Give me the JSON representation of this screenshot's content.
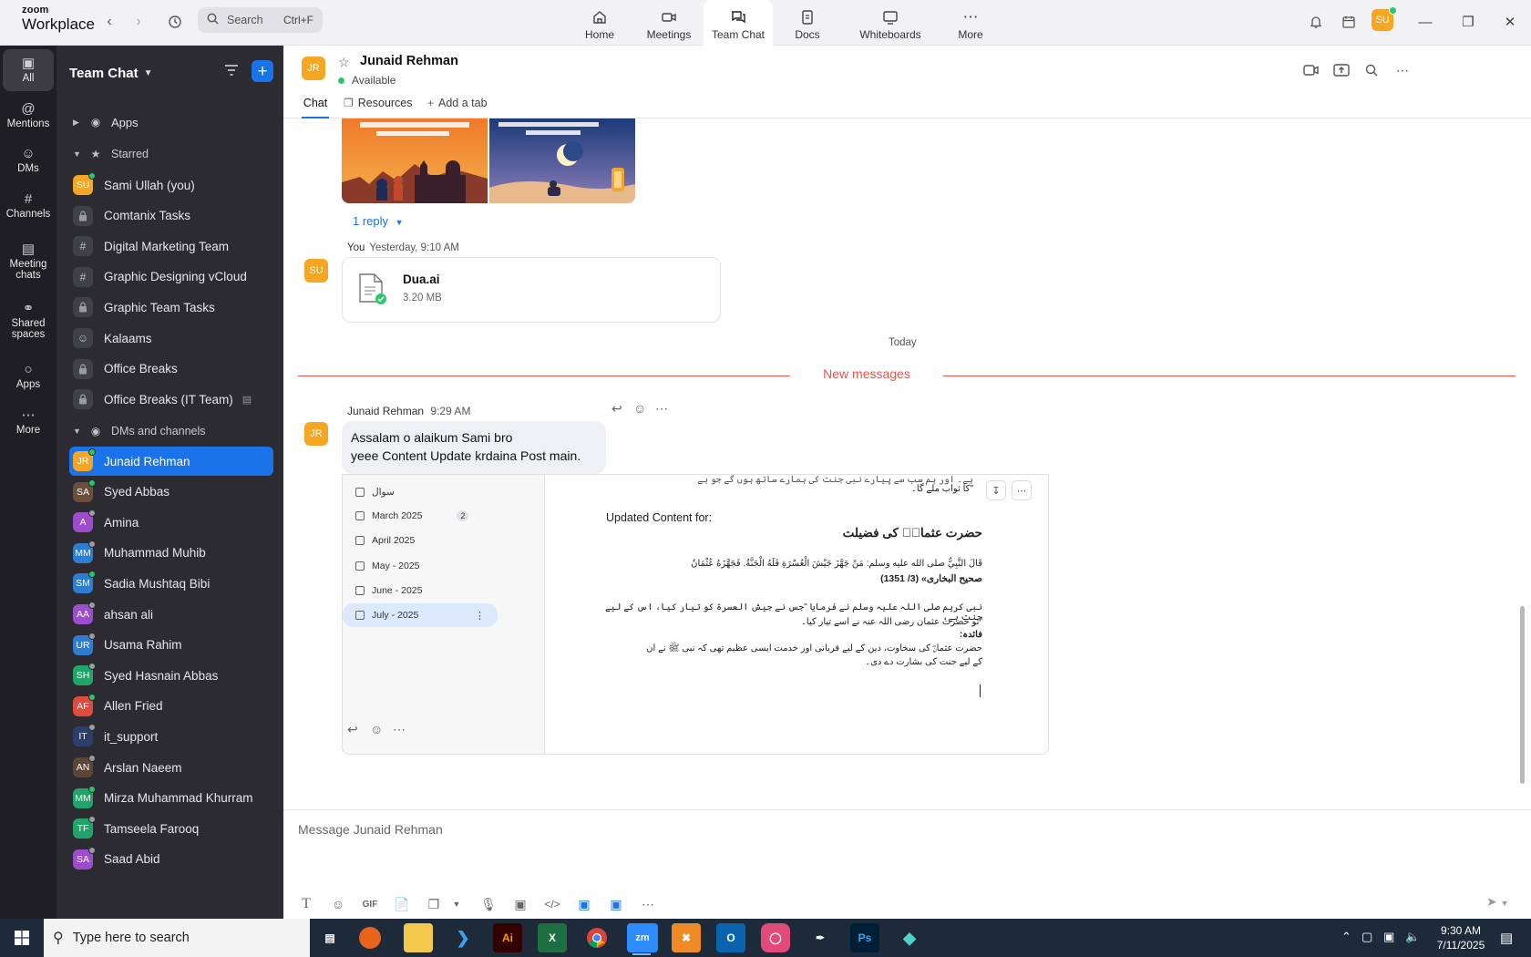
{
  "titlebar": {
    "brand_line1": "zoom",
    "brand_line2": "Workplace",
    "search_placeholder": "Search",
    "search_shortcut": "Ctrl+F",
    "tabs": [
      {
        "label": "Home",
        "icon": "home-icon"
      },
      {
        "label": "Meetings",
        "icon": "video-icon"
      },
      {
        "label": "Team Chat",
        "icon": "chat-icon",
        "active": true
      },
      {
        "label": "Docs",
        "icon": "doc-icon"
      },
      {
        "label": "Whiteboards",
        "icon": "whiteboard-icon"
      },
      {
        "label": "More",
        "icon": "more-icon"
      }
    ],
    "user_initials": "SU"
  },
  "rail": {
    "items": [
      {
        "label": "All",
        "icon": "chat-bubble-icon",
        "active": true
      },
      {
        "label": "Mentions",
        "icon": "at-icon"
      },
      {
        "label": "DMs",
        "icon": "people-icon"
      },
      {
        "label": "Channels",
        "icon": "hash-icon"
      },
      {
        "label": "Meeting chats",
        "icon": "calendar-icon"
      },
      {
        "label": "Shared spaces",
        "icon": "share-icon"
      },
      {
        "label": "Apps",
        "icon": "apps-icon"
      },
      {
        "label": "More",
        "icon": "more-icon"
      }
    ]
  },
  "sidebar": {
    "title": "Team Chat",
    "apps_label": "Apps",
    "starred_label": "Starred",
    "dms_label": "DMs and channels",
    "starred": [
      {
        "label": "Sami Ullah (you)",
        "initials": "SU",
        "color": "#f5a623",
        "status": "on"
      },
      {
        "label": "Comtanix Tasks",
        "kind": "lock"
      },
      {
        "label": "Digital Marketing Team",
        "kind": "hash"
      },
      {
        "label": "Graphic Designing vCloud",
        "kind": "hash"
      },
      {
        "label": "Graphic Team Tasks",
        "kind": "lock"
      },
      {
        "label": "Kalaams",
        "kind": "people"
      },
      {
        "label": "Office Breaks",
        "kind": "lock"
      },
      {
        "label": "Office Breaks (IT Team)",
        "kind": "lock"
      }
    ],
    "dms": [
      {
        "label": "Junaid Rehman",
        "initials": "JR",
        "color": "#f5a623",
        "status": "on",
        "active": true
      },
      {
        "label": "Syed Abbas",
        "initials": "SA",
        "color": "#6b4f3a",
        "status": "on"
      },
      {
        "label": "Amina",
        "initials": "A",
        "color": "#9c4dcc",
        "status": "off"
      },
      {
        "label": "Muhammad Muhib",
        "initials": "MM",
        "color": "#2d7dd2",
        "status": "off"
      },
      {
        "label": "Sadia Mushtaq Bibi",
        "initials": "SM",
        "color": "#2d7dd2",
        "status": "on"
      },
      {
        "label": "ahsan ali",
        "initials": "AA",
        "color": "#9c4dcc",
        "status": "off"
      },
      {
        "label": "Usama Rahim",
        "initials": "UR",
        "color": "#2d7dd2",
        "status": "off"
      },
      {
        "label": "Syed Hasnain Abbas",
        "initials": "SH",
        "color": "#22a36a",
        "status": "off"
      },
      {
        "label": "Allen Fried",
        "initials": "AF",
        "color": "#e04b3f",
        "status": "on"
      },
      {
        "label": "it_support",
        "initials": "IT",
        "color": "#2c3e6b",
        "status": "off"
      },
      {
        "label": "Arslan Naeem",
        "initials": "AN",
        "color": "#5b4636",
        "status": "off"
      },
      {
        "label": "Mirza Muhammad Khurram",
        "initials": "MM",
        "color": "#22a36a",
        "status": "on"
      },
      {
        "label": "Tamseela Farooq",
        "initials": "TF",
        "color": "#22a36a",
        "status": "off"
      },
      {
        "label": "Saad Abid",
        "initials": "SA",
        "color": "#9c4dcc",
        "status": "off"
      }
    ]
  },
  "chat": {
    "peer_initials": "JR",
    "peer_name": "Junaid Rehman",
    "peer_status": "Available",
    "tabs": {
      "chat": "Chat",
      "resources": "Resources",
      "add": "Add a tab"
    },
    "reply_link": "1 reply",
    "msg2": {
      "sender": "You",
      "time": "Yesterday, 9:10 AM",
      "initials": "SU"
    },
    "file": {
      "name": "Dua.ai",
      "size": "3.20 MB"
    },
    "today": "Today",
    "new_messages": "New messages",
    "msg3": {
      "sender": "Junaid Rehman",
      "time": "9:29 AM",
      "initials": "JR",
      "line1": "Assalam o alaikum Sami bro",
      "line2": "yeee Content Update krdaina Post main."
    },
    "screenshot": {
      "side_items": [
        {
          "label": "سوال"
        },
        {
          "label": "March 2025",
          "badge": "2"
        },
        {
          "label": "April 2025"
        },
        {
          "label": "May - 2025"
        },
        {
          "label": "June - 2025"
        },
        {
          "label": "July - 2025",
          "active": true
        }
      ],
      "top_fragment_1": "ہے۔ اور ہم سب سے پیارے نبی جنت کی ہمارے ساتھ ہوں گے جو ہے",
      "top_fragment_2": "\"کا ثواب ملے گا۔",
      "updated_label": "Updated Content for:",
      "heading": "حضرت عثمانؓ کی فضیلت",
      "arabic_line": "قَالَ النَّبِيُّ صلى الله عليه وسلم: مَنْ جَهَّزَ جَيْشَ الْعُسْرَةِ فَلَهُ الْجَنَّةُ. فَجَهَّزَهُ عُثْمَانُ",
      "reference": "(صحیح البخاری» (3/ 1351",
      "urdu_1": "نبی کریم صلی اللہ علیہ وسلم نے فرمایا \"جس نے جیش العسرۃ کو تیار کیا، اس کے لیے جنت ہے،",
      "urdu_2": "\"تو حضرت عثمان رضی اللہ عنہ نے اسے تیار کیا۔",
      "faida": "فائدہ:",
      "urdu_3": "حضرت عثمانؓ کی سخاوت، دین کے لیے قربانی اور خدمت ایسی عظیم تھی کہ نبی ﷺ نے ان",
      "urdu_4": "کے لیے جنت کی بشارت دے دی۔"
    },
    "composer_placeholder": "Message Junaid Rehman"
  },
  "taskbar": {
    "search_placeholder": "Type here to search",
    "time": "9:30 AM",
    "date": "7/11/2025",
    "apps": [
      "task-view",
      "firefox",
      "file-explorer",
      "vscode",
      "illustrator",
      "excel",
      "chrome",
      "zoom",
      "xampp",
      "outlook",
      "creative-cloud",
      "pen-tool",
      "photoshop",
      "app-diamond"
    ]
  },
  "colors": {
    "accent": "#1a73e8",
    "new_messages": "#e8554e",
    "avatar_orange": "#f5a623"
  }
}
